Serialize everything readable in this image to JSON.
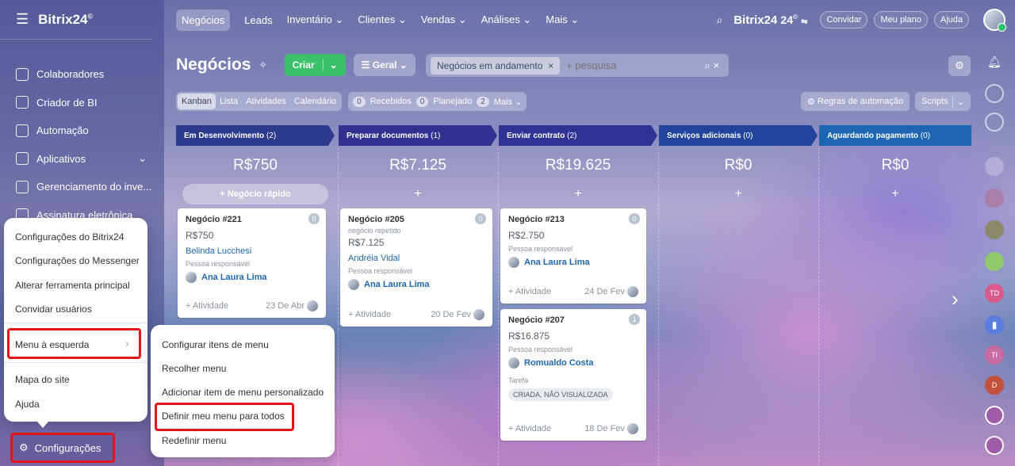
{
  "sidebar": {
    "logo": "Bitrix24",
    "logo_mark": "©",
    "items": [
      "Colaboradores",
      "Criador de BI",
      "Automação",
      "Aplicativos",
      "Gerenciamento do inve...",
      "Assinatura eletrônica"
    ],
    "settings_label": "Configurações"
  },
  "topnav": {
    "items": [
      "Negócios",
      "Leads",
      "Inventário",
      "Clientes",
      "Vendas",
      "Análises",
      "Mais"
    ],
    "brand": "Bitrix24",
    "brand_num": "24",
    "invite": "Convidar",
    "plan": "Meu plano",
    "help": "Ajuda"
  },
  "page": {
    "title": "Negócios",
    "create": "Criar",
    "general": "Geral",
    "filter_chip": "Negócios em andamento",
    "search_placeholder": "+ pesquisa"
  },
  "views": {
    "tabs": [
      "Kanban",
      "Lista",
      "Atividades",
      "Calendário"
    ],
    "counters": [
      {
        "n": "0",
        "label": "Recebidos"
      },
      {
        "n": "0",
        "label": "Planejado"
      },
      {
        "n": "2",
        "label": "Mais"
      }
    ],
    "automation": "Regras de automação",
    "scripts": "Scripts"
  },
  "columns": [
    {
      "title": "Em Desenvolvimento",
      "count": "(2)",
      "sum": "R$750",
      "color": "#2d3b8f",
      "quick": "+ Negócio rápido"
    },
    {
      "title": "Preparar documentos",
      "count": "(1)",
      "sum": "R$7.125",
      "color": "#33318f",
      "quick": "+"
    },
    {
      "title": "Enviar contrato",
      "count": "(2)",
      "sum": "R$19.625",
      "color": "#2f3394",
      "quick": "+"
    },
    {
      "title": "Serviços adicionais",
      "count": "(0)",
      "sum": "R$0",
      "color": "#22449c",
      "quick": "+"
    },
    {
      "title": "Aguardando pagamento",
      "count": "(0)",
      "sum": "R$0",
      "color": "#1d66b3",
      "quick": "+"
    }
  ],
  "cards": [
    {
      "title": "Negócio #221",
      "badge": "0",
      "amount": "R$750",
      "contact": "Belinda Lucchesi",
      "resp_label": "Pessoa responsável",
      "resp": "Ana Laura Lima",
      "activity": "+ Atividade",
      "date": "23 De Abr"
    },
    {
      "title": "Negócio #205",
      "badge": "0",
      "note": "negócio repetido",
      "amount": "R$7.125",
      "contact": "Andréia Vidal",
      "resp_label": "Pessoa responsável",
      "resp": "Ana Laura Lima",
      "activity": "+ Atividade",
      "date": "20 De Fev"
    },
    {
      "title": "Negócio #213",
      "badge": "0",
      "amount": "R$2.750",
      "resp_label": "Pessoa responsável",
      "resp": "Ana Laura Lima",
      "activity": "+ Atividade",
      "date": "24 De Fev"
    },
    {
      "title": "Negócio #207",
      "badge": "1",
      "amount": "R$16.875",
      "resp_label": "Pessoa responsável",
      "resp": "Romualdo Costa",
      "task": "Tarefa",
      "task_status": "CRIADA, NÃO VISUALIZADA",
      "activity": "+ Atividade",
      "date": "18 De Fev"
    }
  ],
  "settings_menu": [
    "Configurações do Bitrix24",
    "Configurações do Messenger",
    "Alterar ferramenta principal",
    "Convidar usuários",
    "Menu à esquerda",
    "Mapa do site",
    "Ajuda"
  ],
  "submenu": [
    "Configurar itens de menu",
    "Recolher menu",
    "Adicionar item de menu personalizado",
    "Definir meu menu para todos",
    "Redefinir menu"
  ],
  "right_avatars": [
    "TD",
    "TI",
    "D"
  ],
  "highlight_color": "#e4141b"
}
